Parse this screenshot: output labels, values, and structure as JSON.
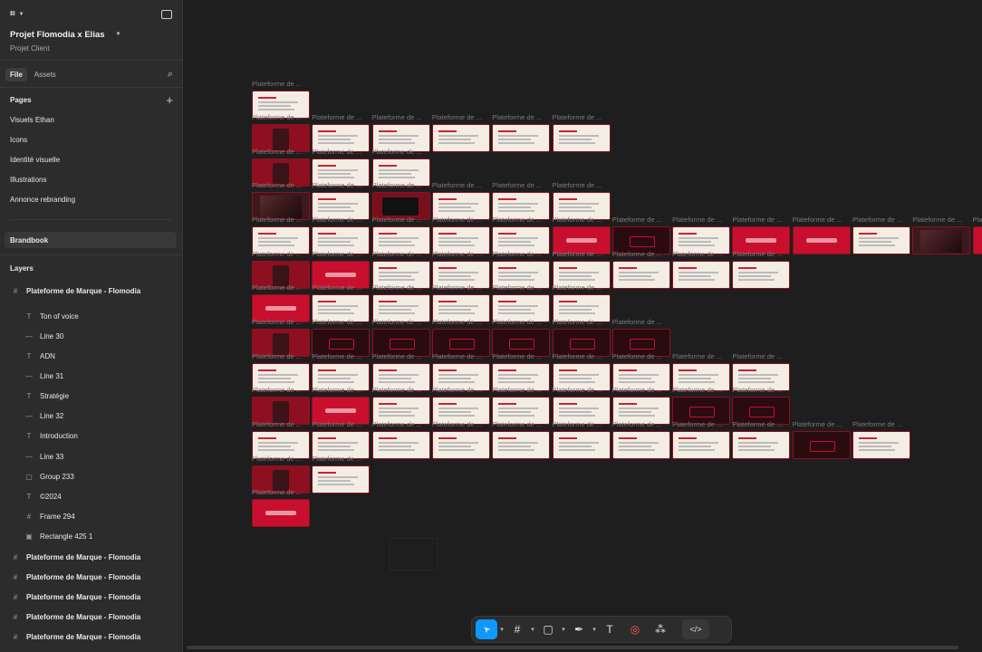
{
  "project": {
    "name": "Projet Flomodia x Elias",
    "subtitle": "Projet Client"
  },
  "panel_tabs": {
    "file": "File",
    "assets": "Assets"
  },
  "pages": {
    "title": "Pages",
    "items": [
      "Visuels Ethan",
      "Icons",
      "Identité visuelle",
      "Illustrations",
      "Annonce rebranding"
    ],
    "selected": "Brandbook"
  },
  "layers": {
    "title": "Layers",
    "root": "Plateforme de Marque - Flomodia",
    "children": [
      {
        "icon": "T",
        "name": "Ton of voice"
      },
      {
        "icon": "—",
        "name": "Line 30"
      },
      {
        "icon": "T",
        "name": "ADN"
      },
      {
        "icon": "—",
        "name": "Line 31"
      },
      {
        "icon": "T",
        "name": "Stratégie"
      },
      {
        "icon": "—",
        "name": "Line 32"
      },
      {
        "icon": "T",
        "name": "Introduction"
      },
      {
        "icon": "—",
        "name": "Line 33"
      },
      {
        "icon": "▢",
        "name": "Group 233"
      },
      {
        "icon": "T",
        "name": "©2024"
      },
      {
        "icon": "#",
        "name": "Frame 294"
      },
      {
        "icon": "▣",
        "name": "Rectangle 425 1"
      }
    ],
    "siblings": [
      "Plateforme de Marque - Flomodia",
      "Plateforme de Marque - Flomodia",
      "Plateforme de Marque - Flomodia",
      "Plateforme de Marque - Flomodia",
      "Plateforme de Marque - Flomodia"
    ]
  },
  "canvas": {
    "frame_label": "Plateforme de ...",
    "rows": [
      [
        "c"
      ],
      [
        "d",
        "c",
        "c",
        "c",
        "c",
        "c"
      ],
      [
        "d",
        "c",
        "c"
      ],
      [
        "p",
        "c",
        "x",
        "c",
        "c",
        "c"
      ],
      [
        "c",
        "c",
        "c",
        "c",
        "c",
        "r",
        "k",
        "c",
        "r",
        "r",
        "c",
        "p",
        "r"
      ],
      [
        "d",
        "r",
        "c",
        "c",
        "c",
        "c",
        "c",
        "c",
        "c"
      ],
      [
        "r",
        "c",
        "c",
        "c",
        "c",
        "c"
      ],
      [
        "d",
        "k",
        "k",
        "k",
        "k",
        "k",
        "k"
      ],
      [
        "c",
        "c",
        "c",
        "c",
        "c",
        "c",
        "c",
        "c",
        "c"
      ],
      [
        "d",
        "r",
        "c",
        "c",
        "c",
        "c",
        "c",
        "k",
        "k"
      ],
      [
        "c",
        "c",
        "c",
        "c",
        "c",
        "c",
        "c",
        "c",
        "c",
        "k",
        "c"
      ],
      [
        "d",
        "c"
      ],
      [
        "r"
      ]
    ]
  },
  "toolbar": {
    "tools": [
      {
        "name": "move-tool",
        "icon": "cursor-arrow-icon",
        "glyph": "➤",
        "active": true,
        "caret": true
      },
      {
        "name": "frame-tool",
        "icon": "frame-hash-icon",
        "glyph": "#",
        "active": false,
        "caret": true
      },
      {
        "name": "shape-tool",
        "icon": "rectangle-icon",
        "glyph": "▢",
        "active": false,
        "caret": true
      },
      {
        "name": "pen-tool",
        "icon": "pen-icon",
        "glyph": "✒",
        "active": false,
        "caret": true
      },
      {
        "name": "text-tool",
        "icon": "text-t-icon",
        "glyph": "T",
        "active": false,
        "caret": false
      },
      {
        "name": "comment-tool",
        "icon": "comment-bubble-icon",
        "glyph": "◎",
        "active": false,
        "caret": false
      },
      {
        "name": "actions-tool",
        "icon": "actions-grid-icon",
        "glyph": "⁂",
        "active": false,
        "caret": false
      },
      {
        "name": "dev-mode-toggle",
        "icon": "code-brackets-icon",
        "glyph": "</>",
        "active": false,
        "caret": false
      }
    ]
  },
  "colors": {
    "accent": "#0d99ff",
    "thumb_red": "#8e1020",
    "thumb_cream": "#f3ede3",
    "thumb_dark": "#2a0b10",
    "thumb_bright": "#c8102e"
  }
}
